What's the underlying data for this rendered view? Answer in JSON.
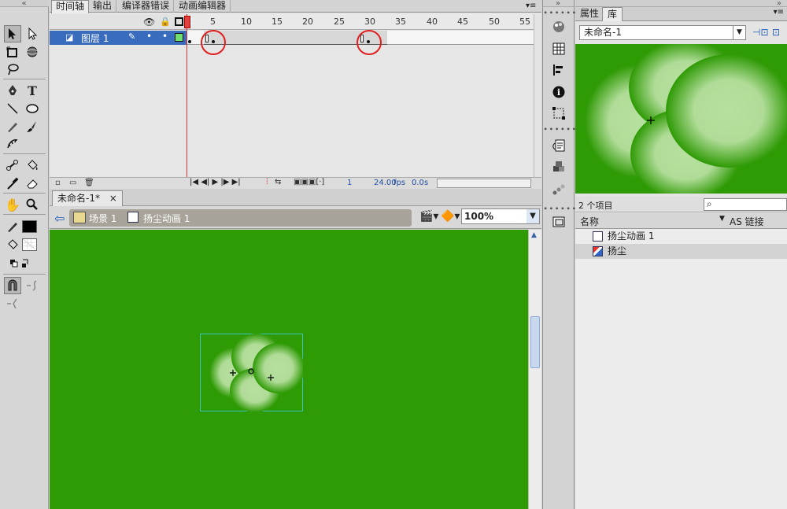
{
  "timeline": {
    "tabs": [
      "时间轴",
      "输出",
      "编译器错误",
      "动画编辑器"
    ],
    "ruler_numbers": [
      "1",
      "5",
      "10",
      "15",
      "20",
      "25",
      "30",
      "35",
      "40",
      "45",
      "50",
      "55"
    ],
    "layer_name": "图层 1",
    "footer": {
      "frame": "1",
      "fps": "24.00",
      "fps_unit": "fps",
      "time": "0.0",
      "time_unit": "s"
    }
  },
  "document": {
    "tab_title": "未命名-1*",
    "close": "×",
    "breadcrumb": [
      "场景 1",
      "扬尘动画 1"
    ],
    "zoom": "100%"
  },
  "library": {
    "tabs": [
      "属性",
      "库"
    ],
    "doc_select": "未命名-1",
    "item_count": "2 个项目",
    "col_name": "名称",
    "col_linkage": "AS 链接",
    "items": [
      {
        "name": "扬尘动画 1",
        "selected": false
      },
      {
        "name": "扬尘",
        "selected": true
      }
    ]
  },
  "colors": {
    "stage": "#2e9a04",
    "layer_selected": "#3a6cbd",
    "keyframe_highlight": "#e02020",
    "dust": "#b3dc9a"
  }
}
